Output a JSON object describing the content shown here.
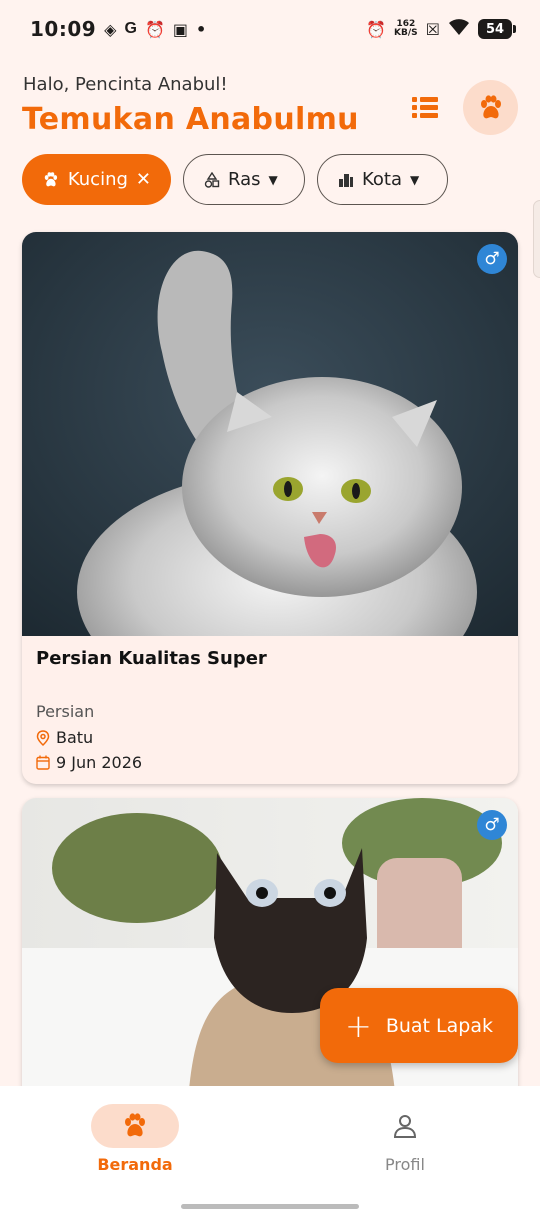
{
  "status_bar": {
    "time": "10:09",
    "net_speed_value": "162",
    "net_speed_unit": "KB/S",
    "battery": "54"
  },
  "header": {
    "greeting": "Halo, Pencinta Anabul!",
    "title": "Temukan Anabulmu"
  },
  "filters": {
    "active_chip": "Kucing",
    "ras_label": "Ras",
    "kota_label": "Kota"
  },
  "listings": [
    {
      "title": "Persian Kualitas Super",
      "breed": "Persian",
      "city": "Batu",
      "date": "9 Jun 2026",
      "gender_symbol": "♂"
    },
    {
      "title": "",
      "breed": "",
      "city": "",
      "date": "",
      "gender_symbol": "♂"
    }
  ],
  "fab": {
    "label": "Buat Lapak"
  },
  "bottom_nav": {
    "items": [
      {
        "label": "Beranda",
        "icon": "paw-icon",
        "active": true
      },
      {
        "label": "Profil",
        "icon": "person-icon",
        "active": false
      }
    ]
  },
  "colors": {
    "accent": "#F26A0A",
    "background": "#FFF3EF",
    "accent_soft": "#FCDCCB",
    "gender_blue": "#2F86D6"
  }
}
